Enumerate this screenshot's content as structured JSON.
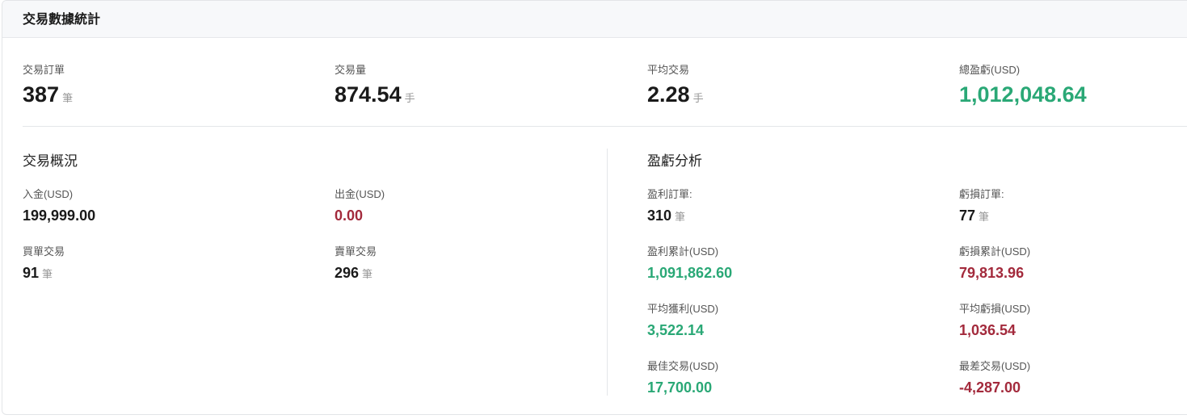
{
  "header": {
    "title": "交易數據統計"
  },
  "top_stats": [
    {
      "label": "交易訂單",
      "value": "387",
      "unit": "筆"
    },
    {
      "label": "交易量",
      "value": "874.54",
      "unit": "手"
    },
    {
      "label": "平均交易",
      "value": "2.28",
      "unit": "手"
    },
    {
      "label": "總盈虧(USD)",
      "value": "1,012,048.64",
      "color": "#2aa876"
    }
  ],
  "overview": {
    "title": "交易概況",
    "deposit": {
      "label": "入金(USD)",
      "value": "199,999.00"
    },
    "withdraw": {
      "label": "出金(USD)",
      "value": "0.00",
      "color": "#a32a3c"
    },
    "buy": {
      "label": "買單交易",
      "value": "91",
      "unit": "筆"
    },
    "sell": {
      "label": "賣單交易",
      "value": "296",
      "unit": "筆"
    }
  },
  "pnl": {
    "title": "盈虧分析",
    "profit_orders": {
      "label": "盈利訂單:",
      "value": "310",
      "unit": "筆"
    },
    "loss_orders": {
      "label": "虧損訂單:",
      "value": "77",
      "unit": "筆"
    },
    "profit_total": {
      "label": "盈利累計(USD)",
      "value": "1,091,862.60",
      "color": "#2aa876"
    },
    "loss_total": {
      "label": "虧損累計(USD)",
      "value": "79,813.96",
      "color": "#a32a3c"
    },
    "avg_profit": {
      "label": "平均獲利(USD)",
      "value": "3,522.14",
      "color": "#2aa876"
    },
    "avg_loss": {
      "label": "平均虧損(USD)",
      "value": "1,036.54",
      "color": "#a32a3c"
    },
    "best_trade": {
      "label": "最佳交易(USD)",
      "value": "17,700.00",
      "color": "#2aa876"
    },
    "worst_trade": {
      "label": "最差交易(USD)",
      "value": "-4,287.00",
      "color": "#a32a3c"
    }
  }
}
